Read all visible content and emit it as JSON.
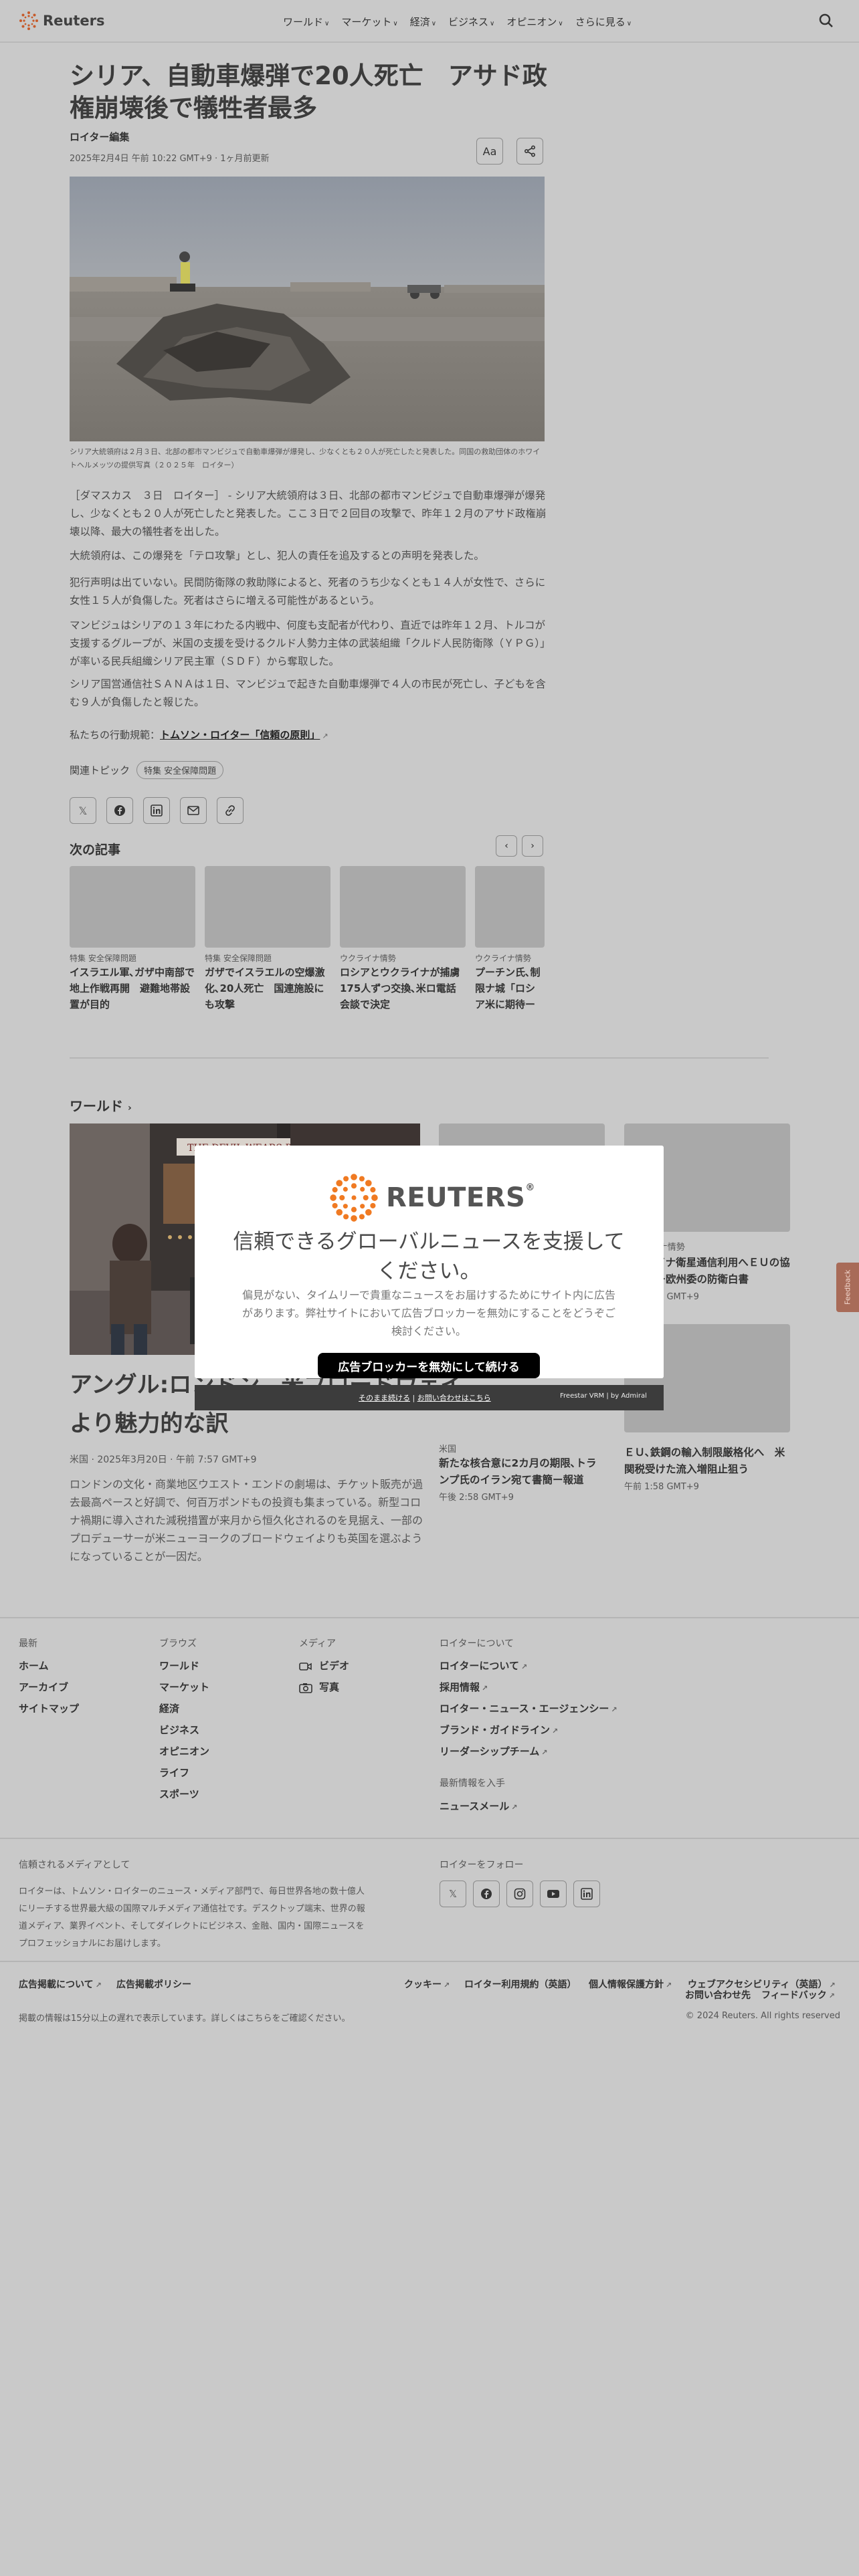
{
  "header": {
    "logo_text": "Reuters",
    "nav": [
      "ワールド",
      "マーケット",
      "経済",
      "ビジネス",
      "オピニオン",
      "さらに見る"
    ]
  },
  "article": {
    "title": "シリア、自動車爆弾で20人死亡　アサド政権崩壊後で犠牲者最多",
    "author": "ロイター編集",
    "date": "2025年2月4日 午前 10:22 GMT+9 · 1ヶ月前更新",
    "text_size_label": "Aa",
    "caption": "シリア大統領府は２月３日、北部の都市マンビジュで自動車爆弾が爆発し、少なくとも２０人が死亡したと発表した。同国の救助団体のホワイトヘルメッツの提供写真（２０２５年　ロイター）",
    "paragraphs": [
      "［ダマスカス　３日　ロイター］ - シリア大統領府は３日、北部の都市マンビジュで自動車爆弾が爆発し、少なくとも２０人が死亡したと発表した。ここ３日で２回目の攻撃で、昨年１２月のアサド政権崩壊以降、最大の犠牲者を出した。",
      "大統領府は、この爆発を「テロ攻撃」とし、犯人の責任を追及するとの声明を発表した。",
      "犯行声明は出ていない。民間防衛隊の救助隊によると、死者のうち少なくとも１４人が女性で、さらに女性１５人が負傷した。死者はさらに増える可能性があるという。",
      "マンビジュはシリアの１３年にわたる内戦中、何度も支配者が代わり、直近では昨年１２月、トルコが支援するグループが、米国の支援を受けるクルド人勢力主体の武装組織「クルド人民防衛隊（ＹＰＧ）」が率いる民兵組織シリア民主軍（ＳＤＦ）から奪取した。",
      "シリア国営通信社ＳＡＮＡは１日、マンビジュで起きた自動車爆弾で４人の市民が死亡し、子どもを含む９人が負傷したと報じた。"
    ],
    "ethics_prefix": "私たちの行動規範：",
    "ethics_link": "トムソン・ロイター「信頼の原則」",
    "topics_label": "関連トピック",
    "topic_chip": "特集 安全保障問題"
  },
  "next_articles": {
    "heading": "次の記事",
    "items": [
      {
        "tag": "特集 安全保障問題",
        "title": "イスラエル軍､ガザ中南部で地上作戦再開　避難地帯設置が目的"
      },
      {
        "tag": "特集 安全保障問題",
        "title": "ガザでイスラエルの空爆激化､20人死亡　国連施設にも攻撃"
      },
      {
        "tag": "ウクライナ情勢",
        "title": "ロシアとウクライナが捕虜175人ずつ交換､米ロ電話会談で決定"
      },
      {
        "tag": "ウクライナ情勢",
        "title": "プーチン氏､制限ナ城「ロシア米に期待ー報"
      }
    ]
  },
  "world": {
    "heading": "ワールド",
    "headline": "アングル:ロンドン、米ブロードウェイより魅力的な訳",
    "meta": "米国 · 2025年3月20日 · 午前 7:57 GMT+9",
    "desc": "ロンドンの文化・商業地区ウエスト・エンドの劇場は、チケット販売が過去最高ペースと好調で、何百万ポンドもの投資も集まっている。新型コロナ禍期に導入された減税措置が来月から恒久化されるのを見据え、一部のプロデューサーが米ニューヨークのブロードウェイよりも英国を選ぶようになっていることが一因だ。",
    "img_sign": "THE DEVIL WEARS PRADA",
    "side": [
      {
        "tag": "ウクライナ情勢",
        "title": "ウクライナ衛星通信利用へＥＵの協議提言ー欧州委の防衛白書",
        "time": "午後 2:58 GMT+9"
      },
      {
        "tag": "米国",
        "title": "新たな核合意に2カ月の期限､トランプ氏のイラン宛て書簡ー報道",
        "time": "午後 2:58 GMT+9"
      },
      {
        "tag": "",
        "title": "ＥＵ､鉄鋼の輸入制限厳格化へ　米関税受けた流入増阻止狙う",
        "time": "午前 1:58 GMT+9"
      }
    ]
  },
  "feedback_label": "Feedback",
  "footer": {
    "cols": [
      {
        "heading": "最新",
        "links": [
          "ホーム",
          "アーカイブ",
          "サイトマップ"
        ]
      },
      {
        "heading": "ブラウズ",
        "links": [
          "ワールド",
          "マーケット",
          "経済",
          "ビジネス",
          "オピニオン",
          "ライフ",
          "スポーツ"
        ]
      },
      {
        "heading": "メディア",
        "links": [
          "ビデオ",
          "写真"
        ]
      },
      {
        "heading": "ロイターについて",
        "links": [
          "ロイターについて",
          "採用情報",
          "ロイター・ニュース・エージェンシー",
          "ブランド・ガイドライン",
          "リーダーシップチーム"
        ]
      }
    ],
    "latest_heading": "最新情報を入手",
    "newsletter": "ニュースメール",
    "trusted_heading": "信頼されるメディアとして",
    "trusted_desc": "ロイターは、トムソン・ロイターのニュース・メディア部門で、毎日世界各地の数十億人にリーチする世界最大級の国際マルチメディア通信社です。デスクトップ端末、世界の報道メディア、業界イベント、そしてダイレクトにビジネス、金融、国内・国際ニュースをプロフェッショナルにお届けします。",
    "follow_heading": "ロイターをフォロー",
    "bottom_links_left": [
      "広告掲載について",
      "広告掲載ポリシー"
    ],
    "bottom_links_right": [
      "クッキー",
      "ロイター利用規約（英語）",
      "個人情報保護方針",
      "ウェブアクセシビリティ（英語）"
    ],
    "bottom_links_right2": [
      "お問い合わせ先",
      "フィードバック"
    ],
    "delay_note": "掲載の情報は15分以上の遅れで表示しています。詳しくはこちらをご確認ください。",
    "copyright": "© 2024 Reuters. All rights reserved"
  },
  "modal": {
    "brand": "REUTERS",
    "reg": "®",
    "heading": "信頼できるグローバルニュースを支援してください。",
    "body": "偏見がない、タイムリーで貴重なニュースをお届けするためにサイト内に広告があります。弊社サイトにおいて広告ブロッカーを無効にすることをどうぞご検討ください。",
    "button": "広告ブロッカーを無効にして続ける",
    "link1": "そのまま続ける",
    "link2": "お問い合わせはこちら",
    "credit": "Freestar VRM  |  by Admiral"
  }
}
